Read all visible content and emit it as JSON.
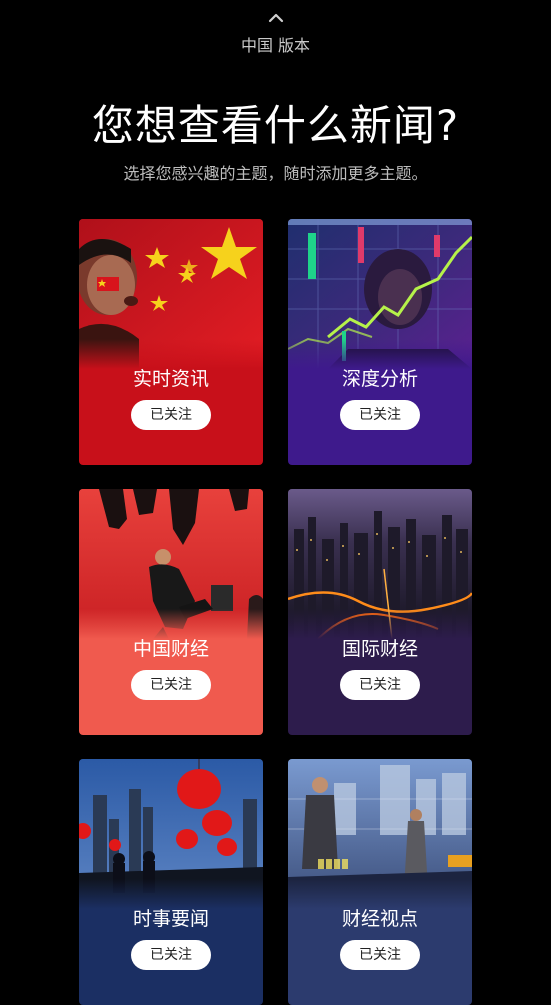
{
  "edition": {
    "chevron_icon": "chevron-up-icon",
    "label": "中国 版本"
  },
  "header": {
    "title": "您想查看什么新闻?",
    "subtitle": "选择您感兴趣的主题，随时添加更多主题。"
  },
  "topics": [
    {
      "title": "实时资讯",
      "button": "已关注",
      "color": "#c8101a",
      "image": "protester-with-flag-face-paint-photo"
    },
    {
      "title": "深度分析",
      "button": "已关注",
      "color": "#3e1a8c",
      "image": "stock-chart-screen-photo"
    },
    {
      "title": "中国财经",
      "button": "已关注",
      "color": "#f05a4e",
      "image": "businessman-on-phone-photo"
    },
    {
      "title": "国际财经",
      "button": "已关注",
      "color": "#2d1c4c",
      "image": "city-night-skyline-photo"
    },
    {
      "title": "时事要闻",
      "button": "已关注",
      "color": "#1b2f63",
      "image": "red-lanterns-skyline-photo"
    },
    {
      "title": "财经视点",
      "button": "已关注",
      "color": "#2c3b6e",
      "image": "stock-ticker-street-photo"
    }
  ]
}
